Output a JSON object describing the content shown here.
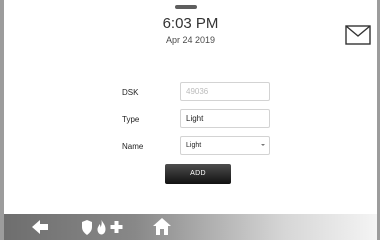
{
  "status": {
    "time": "6:03 PM",
    "date": "Apr 24 2019"
  },
  "form": {
    "dsk_label": "DSK",
    "dsk_value": "49036",
    "type_label": "Type",
    "type_value": "Light",
    "name_label": "Name",
    "name_selected": "Light",
    "add_label": "ADD"
  },
  "icons": {
    "messages": "envelope-icon",
    "back": "arrow-left-icon",
    "security": "shield-icon",
    "fire": "flame-icon",
    "medical": "cross-icon",
    "home": "house-icon"
  }
}
